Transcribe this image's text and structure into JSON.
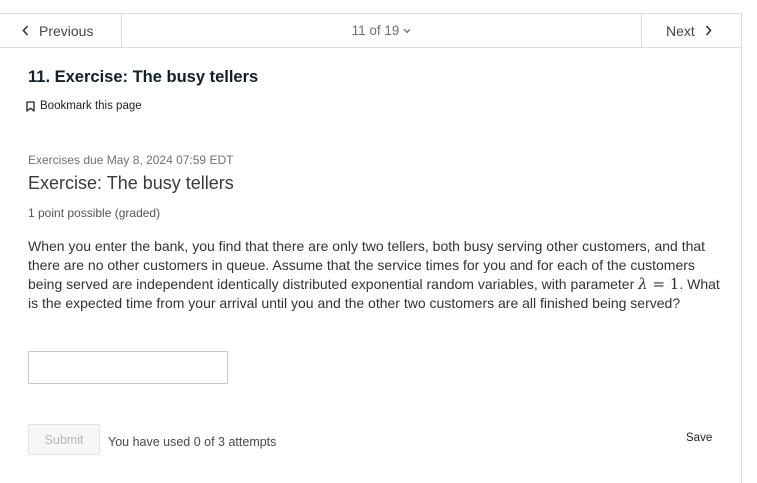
{
  "nav": {
    "previous_label": "Previous",
    "position_label": "11 of 19",
    "next_label": "Next"
  },
  "unit": {
    "title": "11. Exercise: The busy tellers",
    "bookmark_label": "Bookmark this page"
  },
  "problem": {
    "due": "Exercises due May 8, 2024 07:59 EDT",
    "title": "Exercise: The busy tellers",
    "points": "1 point possible (graded)",
    "text_before_math": "When you enter the bank, you find that there are only two tellers, both busy serving other customers, and that there are no other customers in queue. Assume that the service times for you and for each of the customers being served are independent identically distributed exponential random variables, with parameter ",
    "math_symbol": "λ",
    "math_equals": " = ",
    "math_value": "1",
    "text_after_math": ". What is the expected time from your arrival until you and the other two customers are all finished being served?",
    "answer_value": ""
  },
  "actions": {
    "submit_label": "Submit",
    "attempts_text": "You have used 0 of 3 attempts",
    "save_label": "Save"
  },
  "icons": {
    "previous": "chevron-left-icon",
    "next": "chevron-right-icon",
    "position_dropdown": "chevron-down-icon",
    "bookmark": "bookmark-icon"
  }
}
